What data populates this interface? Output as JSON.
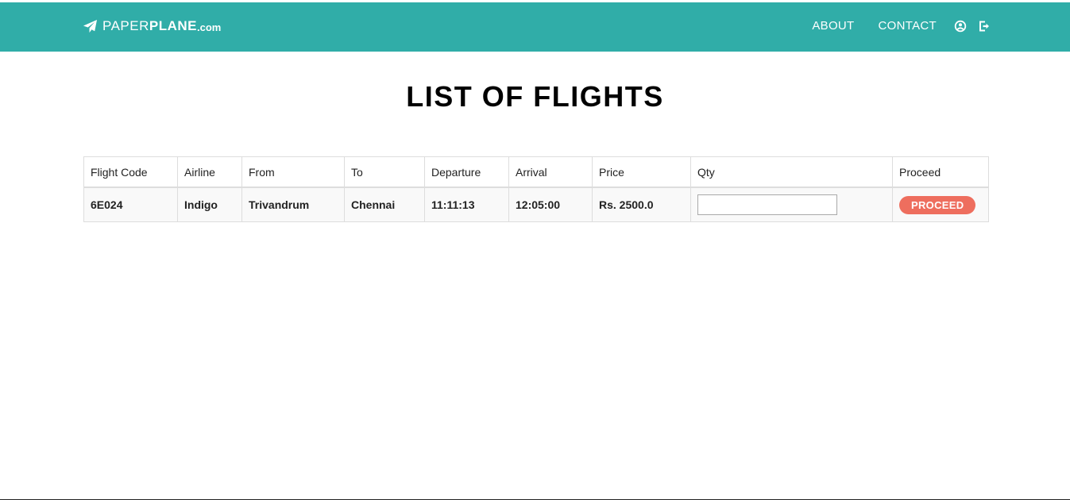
{
  "brand": {
    "paper": "PAPER",
    "plane": "PLANE",
    "tld": ".com"
  },
  "nav": {
    "about": "ABOUT",
    "contact": "CONTACT",
    "icons": [
      "user-circle-icon",
      "logout-icon"
    ]
  },
  "colors": {
    "navbar": "#30ada8",
    "proceed_button": "#ee6e5e"
  },
  "page_title": "LIST OF FLIGHTS",
  "table": {
    "headers": [
      "Flight Code",
      "Airline",
      "From",
      "To",
      "Departure",
      "Arrival",
      "Price",
      "Qty",
      "Proceed"
    ],
    "rows": [
      {
        "flight_code": "6E024",
        "airline": "Indigo",
        "from": "Trivandrum",
        "to": "Chennai",
        "departure": "11:11:13",
        "arrival": "12:05:00",
        "price": "Rs. 2500.0",
        "qty": "",
        "proceed_label": "PROCEED"
      }
    ]
  }
}
